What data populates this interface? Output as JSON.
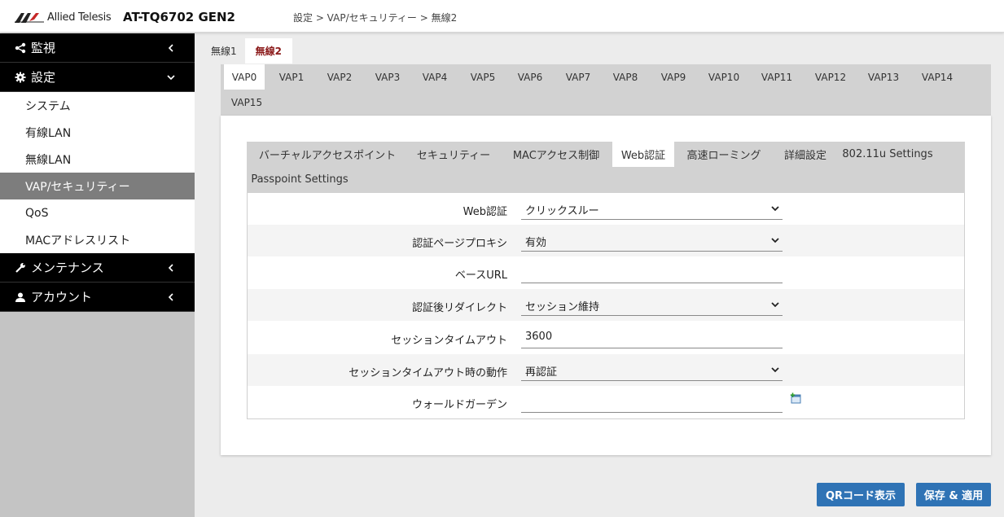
{
  "header": {
    "brand": "Allied Telesis",
    "model": "AT-TQ6702 GEN2",
    "breadcrumb": "設定 > VAP/セキュリティー > 無線2"
  },
  "sidebar": {
    "monitor": "監視",
    "settings": "設定",
    "settings_items": [
      "システム",
      "有線LAN",
      "無線LAN",
      "VAP/セキュリティー",
      "QoS",
      "MACアドレスリスト"
    ],
    "active_item": "VAP/セキュリティー",
    "maintenance": "メンテナンス",
    "account": "アカウント"
  },
  "radio_tabs": [
    "無線1",
    "無線2"
  ],
  "vap_tabs": [
    "VAP0",
    "VAP1",
    "VAP2",
    "VAP3",
    "VAP4",
    "VAP5",
    "VAP6",
    "VAP7",
    "VAP8",
    "VAP9",
    "VAP10",
    "VAP11",
    "VAP12",
    "VAP13",
    "VAP14",
    "VAP15"
  ],
  "sub_tabs": [
    "バーチャルアクセスポイント",
    "セキュリティー",
    "MACアクセス制御",
    "Web認証",
    "高速ローミング",
    "詳細設定",
    "802.11u Settings",
    "Passpoint Settings"
  ],
  "form": {
    "web_auth": {
      "label": "Web認証",
      "value": "クリックスルー"
    },
    "auth_proxy": {
      "label": "認証ページプロキシ",
      "value": "有効"
    },
    "base_url": {
      "label": "ベースURL",
      "value": ""
    },
    "redirect": {
      "label": "認証後リダイレクト",
      "value": "セッション維持"
    },
    "session_timeout": {
      "label": "セッションタイムアウト",
      "value": "3600"
    },
    "timeout_action": {
      "label": "セッションタイムアウト時の動作",
      "value": "再認証"
    },
    "walled_garden": {
      "label": "ウォールドガーデン",
      "value": ""
    }
  },
  "buttons": {
    "qr": "QRコード表示",
    "save": "保存 & 適用"
  },
  "colors": {
    "accent": "#2f73b5",
    "active_radio_tab": "#8b1a1a",
    "sidebar_head": "#000000",
    "sidebar_active": "#7d7d7d"
  }
}
